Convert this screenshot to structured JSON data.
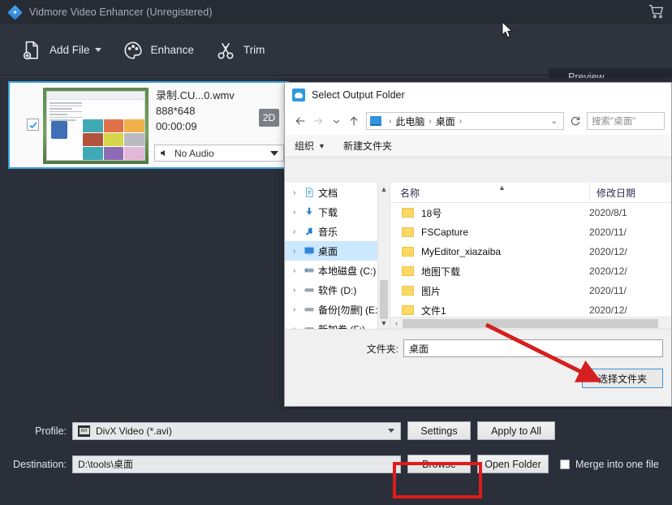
{
  "app": {
    "title": "Vidmore Video Enhancer (Unregistered)",
    "logo_icon": "vidmore-diamond-logo",
    "cart_icon": "shopping-cart-icon",
    "toolbar": [
      {
        "label": "Add File",
        "icon": "add-file-icon",
        "has_caret": true
      },
      {
        "label": "Enhance",
        "icon": "palette-icon",
        "has_caret": false
      },
      {
        "label": "Trim",
        "icon": "scissors-icon",
        "has_caret": false
      }
    ],
    "preview_label": "Preview"
  },
  "file_item": {
    "name": "录制.CU...0.wmv",
    "resolution": "888*648",
    "duration": "00:00:09",
    "badge": "2D",
    "audio": "No Audio",
    "audio_icon": "speaker-icon",
    "add_icon": "plus-icon",
    "checked": true
  },
  "dialog": {
    "title": "Select Output Folder",
    "title_icon": "folder-cloud-icon",
    "nav": {
      "back_icon": "arrow-left-icon",
      "forward_icon": "arrow-right-icon",
      "recent_icon": "chevron-down-icon",
      "up_icon": "arrow-up-icon",
      "refresh_icon": "refresh-icon",
      "crumb_icon": "this-pc-icon",
      "crumbs": [
        "此电脑",
        "桌面"
      ],
      "search_placeholder": "搜索\"桌面\""
    },
    "commands": [
      {
        "label": "组织",
        "has_caret": true
      },
      {
        "label": "新建文件夹",
        "has_caret": false
      }
    ],
    "tree": [
      {
        "label": "文档",
        "icon": "documents-icon",
        "selected": false
      },
      {
        "label": "下载",
        "icon": "downloads-icon",
        "selected": false
      },
      {
        "label": "音乐",
        "icon": "music-icon",
        "selected": false
      },
      {
        "label": "桌面",
        "icon": "desktop-icon",
        "selected": true
      },
      {
        "label": "本地磁盘 (C:)",
        "icon": "system-drive-icon",
        "selected": false
      },
      {
        "label": "软件 (D:)",
        "icon": "drive-icon",
        "selected": false
      },
      {
        "label": "备份[勿删] (E:)",
        "icon": "drive-icon",
        "selected": false
      },
      {
        "label": "新加卷 (F:)",
        "icon": "drive-icon",
        "selected": false
      }
    ],
    "columns": [
      "名称",
      "修改日期"
    ],
    "files": [
      {
        "name": "18号",
        "date": "2020/8/1"
      },
      {
        "name": "FSCapture",
        "date": "2020/11/"
      },
      {
        "name": "MyEditor_xiazaiba",
        "date": "2020/12/"
      },
      {
        "name": "地图下载",
        "date": "2020/12/"
      },
      {
        "name": "图片",
        "date": "2020/11/"
      },
      {
        "name": "文件1",
        "date": "2020/12/"
      }
    ],
    "folder_label": "文件夹:",
    "folder_value": "桌面",
    "choose_button": "选择文件夹"
  },
  "bottom": {
    "profile_label": "Profile:",
    "profile_value": "DivX Video (*.avi)",
    "profile_icon": "avi-film-icon",
    "settings_button": "Settings",
    "apply_all_button": "Apply to All",
    "destination_label": "Destination:",
    "destination_value": "D:\\tools\\桌面",
    "browse_button": "Browse",
    "open_folder_button": "Open Folder",
    "merge_label": "Merge into one file",
    "merge_checked": false
  },
  "annotations": {
    "arrow_color": "#d42020",
    "box_color": "#e01b1b"
  }
}
